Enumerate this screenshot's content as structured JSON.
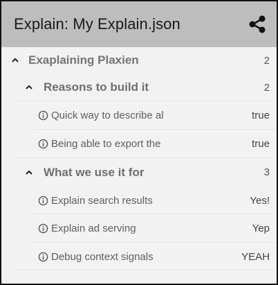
{
  "header": {
    "title": "Explain: My Explain.json",
    "share_icon": "share-icon"
  },
  "tree": {
    "label": "Exaplaining Plaxien",
    "count": "2",
    "groups": [
      {
        "label": "Reasons to build it",
        "count": "2",
        "items": [
          {
            "label": "Quick way to describe al",
            "value": "true"
          },
          {
            "label": "Being able to export the",
            "value": "true"
          }
        ]
      },
      {
        "label": "What we use it for",
        "count": "3",
        "items": [
          {
            "label": "Explain search results",
            "value": "Yes!"
          },
          {
            "label": "Explain ad serving",
            "value": "Yep"
          },
          {
            "label": "Debug context signals",
            "value": "YEAH"
          }
        ]
      }
    ]
  }
}
